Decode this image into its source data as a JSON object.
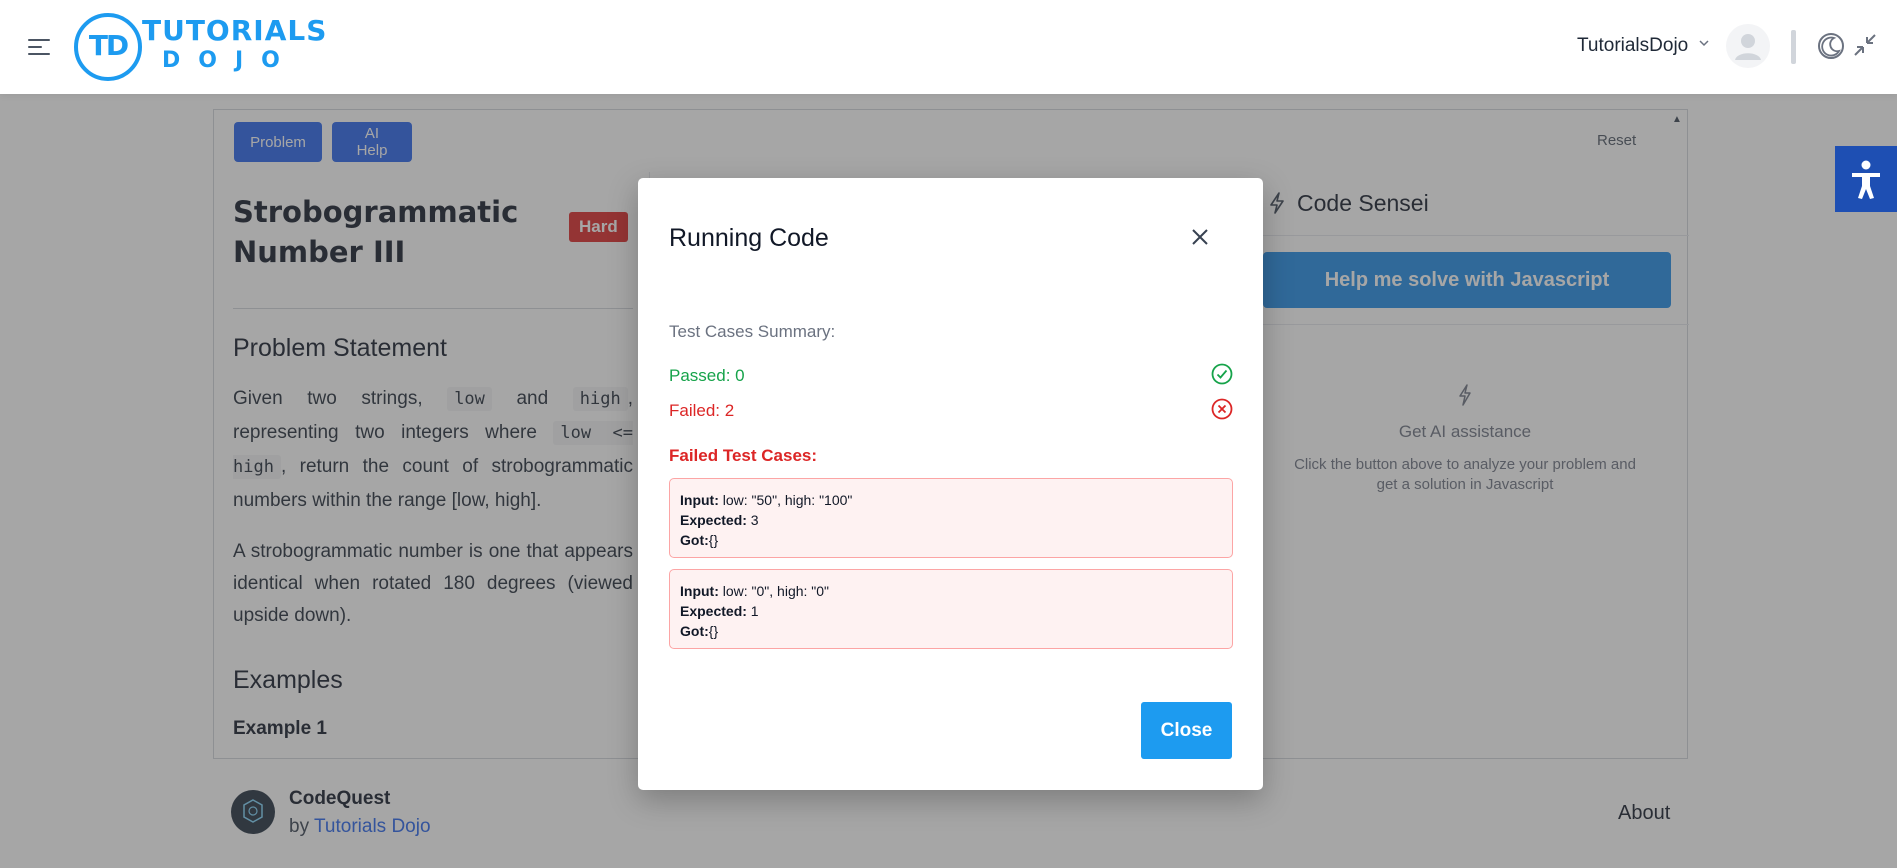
{
  "header": {
    "logo_top": "TUTORIALS",
    "logo_bottom": "DOJO",
    "logo_mark": "TD",
    "user_name": "TutorialsDojo"
  },
  "toolbar": {
    "problem_tab": "Problem",
    "ai_help_tab": "AI Help",
    "reset_label": "Reset"
  },
  "problem": {
    "title": "Strobogrammatic Number III",
    "difficulty": "Hard",
    "statement_heading": "Problem Statement",
    "statement_parts": [
      "Given two strings, ",
      "low",
      " and ",
      "high",
      ", representing two integers where ",
      "low <= high",
      ", return the count of strobogrammatic numbers within the range [low, high]."
    ],
    "definition": "A strobogrammatic number is one that appears identical when rotated 180 degrees (viewed upside down).",
    "examples_heading": "Examples",
    "example1_label": "Example 1"
  },
  "sensei": {
    "title": "Code Sensei",
    "help_button": "Help me solve with Javascript",
    "assist_title": "Get AI assistance",
    "assist_desc": "Click the button above to analyze your problem and get a solution in Javascript"
  },
  "footer": {
    "app_name": "CodeQuest",
    "by_prefix": "by ",
    "by_link": "Tutorials Dojo",
    "about": "About"
  },
  "modal": {
    "title": "Running Code",
    "summary_label": "Test Cases Summary:",
    "passed": "Passed: 0",
    "failed": "Failed: 2",
    "failed_heading": "Failed Test Cases:",
    "input_label": "Input:",
    "expected_label": "Expected:",
    "got_label": "Got:",
    "cases": [
      {
        "input": " low: \"50\", high: \"100\"",
        "expected": " 3",
        "got": "{}"
      },
      {
        "input": " low: \"0\", high: \"0\"",
        "expected": " 1",
        "got": "{}"
      }
    ],
    "close_button": "Close"
  },
  "colors": {
    "primary_blue": "#2563eb",
    "brand_blue": "#1d9bf0",
    "danger_red": "#dc2626",
    "success_green": "#16a34a"
  }
}
